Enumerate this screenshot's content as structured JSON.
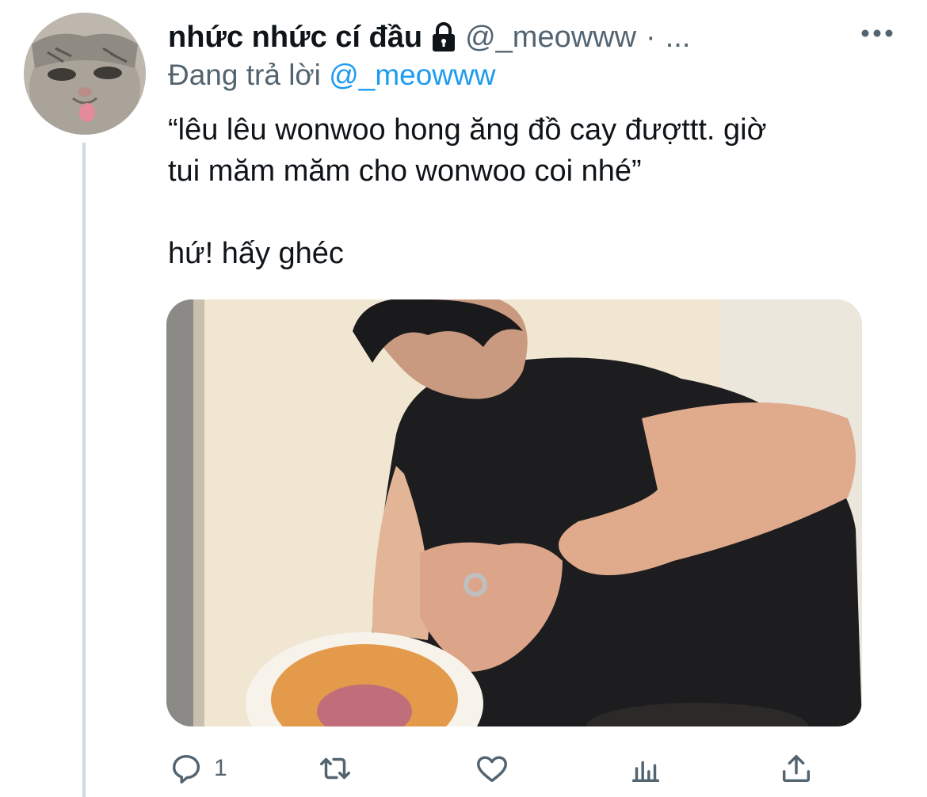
{
  "tweet": {
    "display_name": "nhức nhức cí đầu",
    "handle": "@_meowww",
    "separator": "·",
    "truncation": "...",
    "reply_prefix": "Đang trả lời",
    "reply_to": "@_meowww",
    "text_line1": "“lêu lêu wonwoo hong ăng đồ cay đượttt. giờ",
    "text_line2": "tui măm măm cho wonwoo coi nhé”",
    "text_line3": "hứ! hấy ghéc",
    "reply_count": "1"
  },
  "icons": {
    "lock": "lock-icon",
    "more": "more-horizontal-icon",
    "reply": "reply-icon",
    "retweet": "retweet-icon",
    "like": "heart-icon",
    "views": "analytics-icon",
    "share": "share-icon"
  },
  "colors": {
    "link": "#1d9bf0",
    "secondary": "#536471",
    "primary": "#0f1419"
  }
}
